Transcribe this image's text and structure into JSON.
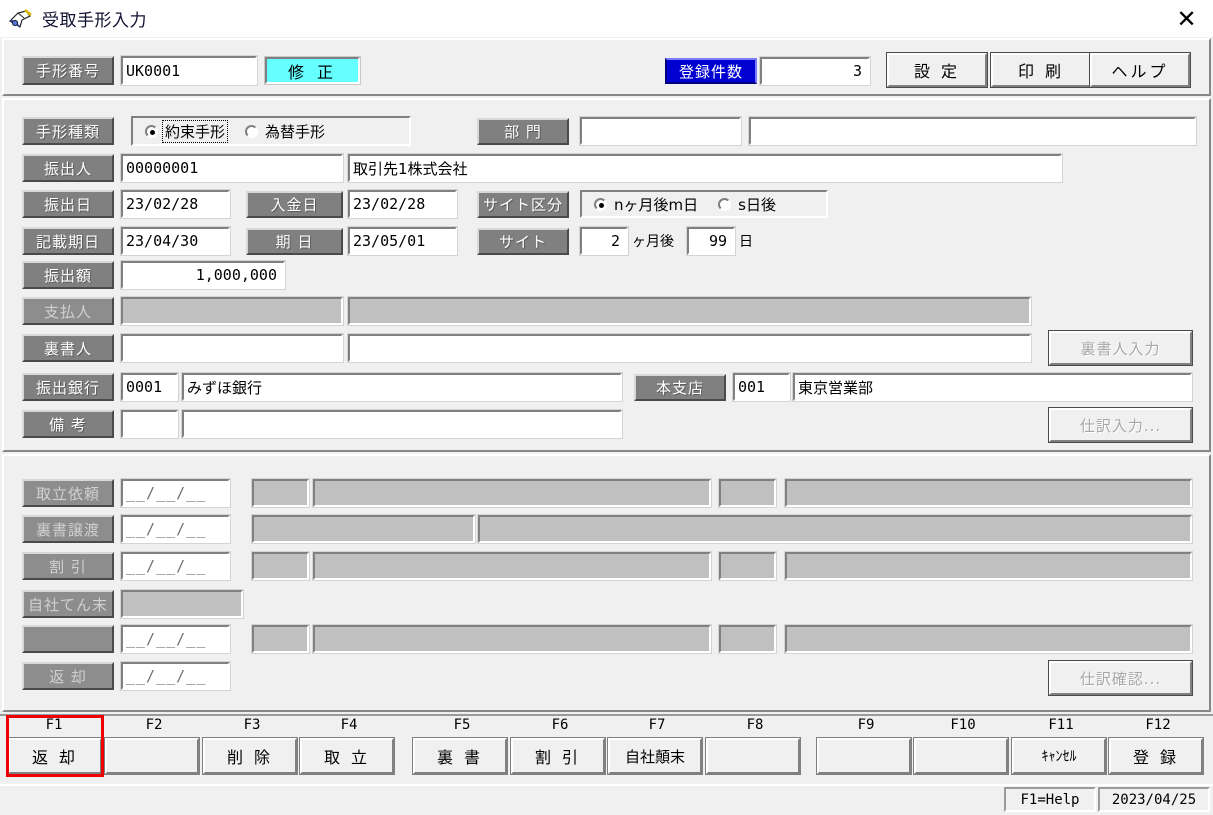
{
  "window": {
    "title": "受取手形入力",
    "icon": "pen-write-icon",
    "close_label": "✕"
  },
  "header": {
    "bill_no_label": "手形番号",
    "bill_no_value": "UK0001",
    "mode_badge": "修 正",
    "count_label": "登録件数",
    "count_value": "3",
    "buttons": [
      {
        "name": "settings",
        "label": "設 定"
      },
      {
        "name": "print",
        "label": "印 刷"
      },
      {
        "name": "help",
        "label": "ヘルプ"
      }
    ]
  },
  "main": {
    "bill_type": {
      "label": "手形種類",
      "options": [
        "約束手形",
        "為替手形"
      ],
      "selected_index": 0
    },
    "department": {
      "label": "部 門",
      "code": "",
      "name": ""
    },
    "drawer": {
      "label": "振出人",
      "code": "00000001",
      "name": "取引先1株式会社"
    },
    "issue_date": {
      "label": "振出日",
      "value": "23/02/28"
    },
    "deposit_date": {
      "label": "入金日",
      "value": "23/02/28"
    },
    "site_kbn": {
      "label": "サイト区分",
      "options": [
        "nヶ月後m日",
        "s日後"
      ],
      "selected_index": 0
    },
    "written_date": {
      "label": "記載期日",
      "value": "23/04/30"
    },
    "due_date": {
      "label": "期 日",
      "value": "23/05/01"
    },
    "site": {
      "label": "サイト",
      "months": "2",
      "months_suffix": "ヶ月後",
      "days": "99",
      "days_suffix": "日"
    },
    "amount": {
      "label": "振出額",
      "value": "1,000,000"
    },
    "payer": {
      "label": "支払人",
      "code": "",
      "name": "",
      "disabled": true
    },
    "endorser": {
      "label": "裏書人",
      "code": "",
      "name": ""
    },
    "endorser_button": {
      "label": "裏書人入力",
      "disabled": true
    },
    "draw_bank": {
      "label": "振出銀行",
      "code": "0001",
      "name": "みずほ銀行"
    },
    "branch": {
      "label": "本支店",
      "code": "001",
      "name": "東京営業部"
    },
    "remarks": {
      "label": "備 考",
      "code": "",
      "text": ""
    },
    "journal_button": {
      "label": "仕訳入力...",
      "disabled": true
    }
  },
  "history": {
    "rows": [
      {
        "label": "取立依頼",
        "date": "__/__/__",
        "code": "",
        "name": "",
        "code2": "",
        "name2": "",
        "style": "split"
      },
      {
        "label": "裏書譲渡",
        "date": "__/__/__",
        "code": "",
        "name": "",
        "style": "wide"
      },
      {
        "label": "割  引",
        "date": "__/__/__",
        "code": "",
        "name": "",
        "code2": "",
        "name2": "",
        "style": "split"
      },
      {
        "label": "自社てん末",
        "date": "",
        "code": "",
        "name": "",
        "style": "single"
      },
      {
        "label": "",
        "date": "__/__/__",
        "code": "",
        "name": "",
        "code2": "",
        "name2": "",
        "style": "split"
      },
      {
        "label": "返  却",
        "date": "__/__/__",
        "style": "dateonly"
      }
    ],
    "confirm_button": {
      "label": "仕訳確認...",
      "disabled": true
    }
  },
  "fkeys": [
    {
      "key": "F1",
      "label": "返 却",
      "highlighted": true
    },
    {
      "key": "F2",
      "label": "",
      "highlighted": false
    },
    {
      "key": "F3",
      "label": "削 除",
      "highlighted": false
    },
    {
      "key": "F4",
      "label": "取 立",
      "highlighted": false
    },
    {
      "key": "F5",
      "label": "裏 書",
      "highlighted": false
    },
    {
      "key": "F6",
      "label": "割 引",
      "highlighted": false
    },
    {
      "key": "F7",
      "label": "自社顛末",
      "highlighted": false
    },
    {
      "key": "F8",
      "label": "",
      "highlighted": false
    },
    {
      "key": "F9",
      "label": "",
      "highlighted": false
    },
    {
      "key": "F10",
      "label": "",
      "highlighted": false
    },
    {
      "key": "F11",
      "label": "ｷｬﾝｾﾙ",
      "highlighted": false
    },
    {
      "key": "F12",
      "label": "登 録",
      "highlighted": false
    }
  ],
  "statusbar": {
    "help_hint": "F1=Help",
    "date": "2023/04/25"
  },
  "colors": {
    "face": "#f0f0f0",
    "label_gray": "#808080",
    "badge_cyan": "#66ffff",
    "count_blue": "#0000d0",
    "highlight_red": "#ee0000",
    "disabled_field": "#c0c0c0"
  }
}
